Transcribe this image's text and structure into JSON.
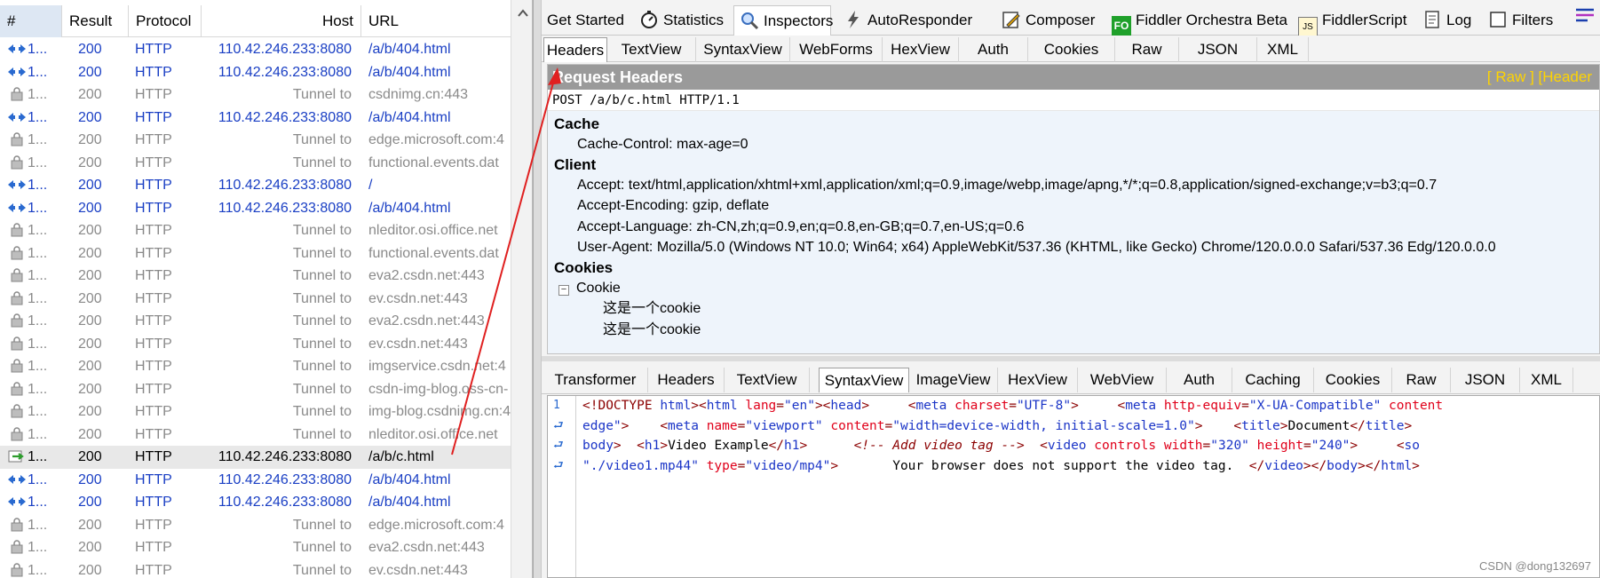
{
  "list": {
    "columns": [
      "#",
      "Result",
      "Protocol",
      "Host",
      "URL"
    ],
    "rows": [
      {
        "num": "1...",
        "result": "200",
        "protocol": "HTTP",
        "host": "110.42.246.233:8080",
        "url": "/a/b/404.html",
        "kind": "req",
        "icon": "arrows-icon"
      },
      {
        "num": "1...",
        "result": "200",
        "protocol": "HTTP",
        "host": "110.42.246.233:8080",
        "url": "/a/b/404.html",
        "kind": "req",
        "icon": "arrows-icon"
      },
      {
        "num": "1...",
        "result": "200",
        "protocol": "HTTP",
        "host": "Tunnel to",
        "url": "csdnimg.cn:443",
        "kind": "tunnel",
        "icon": "lock-icon"
      },
      {
        "num": "1...",
        "result": "200",
        "protocol": "HTTP",
        "host": "110.42.246.233:8080",
        "url": "/a/b/404.html",
        "kind": "req",
        "icon": "arrows-icon"
      },
      {
        "num": "1...",
        "result": "200",
        "protocol": "HTTP",
        "host": "Tunnel to",
        "url": "edge.microsoft.com:4",
        "kind": "tunnel",
        "icon": "lock-icon"
      },
      {
        "num": "1...",
        "result": "200",
        "protocol": "HTTP",
        "host": "Tunnel to",
        "url": "functional.events.dat",
        "kind": "tunnel",
        "icon": "lock-icon"
      },
      {
        "num": "1...",
        "result": "200",
        "protocol": "HTTP",
        "host": "110.42.246.233:8080",
        "url": "/",
        "kind": "req",
        "icon": "arrows-icon"
      },
      {
        "num": "1...",
        "result": "200",
        "protocol": "HTTP",
        "host": "110.42.246.233:8080",
        "url": "/a/b/404.html",
        "kind": "req",
        "icon": "arrows-icon"
      },
      {
        "num": "1...",
        "result": "200",
        "protocol": "HTTP",
        "host": "Tunnel to",
        "url": "nleditor.osi.office.net",
        "kind": "tunnel",
        "icon": "lock-icon"
      },
      {
        "num": "1...",
        "result": "200",
        "protocol": "HTTP",
        "host": "Tunnel to",
        "url": "functional.events.dat",
        "kind": "tunnel",
        "icon": "lock-icon"
      },
      {
        "num": "1...",
        "result": "200",
        "protocol": "HTTP",
        "host": "Tunnel to",
        "url": "eva2.csdn.net:443",
        "kind": "tunnel",
        "icon": "lock-icon"
      },
      {
        "num": "1...",
        "result": "200",
        "protocol": "HTTP",
        "host": "Tunnel to",
        "url": "ev.csdn.net:443",
        "kind": "tunnel",
        "icon": "lock-icon"
      },
      {
        "num": "1...",
        "result": "200",
        "protocol": "HTTP",
        "host": "Tunnel to",
        "url": "eva2.csdn.net:443",
        "kind": "tunnel",
        "icon": "lock-icon"
      },
      {
        "num": "1...",
        "result": "200",
        "protocol": "HTTP",
        "host": "Tunnel to",
        "url": "ev.csdn.net:443",
        "kind": "tunnel",
        "icon": "lock-icon"
      },
      {
        "num": "1...",
        "result": "200",
        "protocol": "HTTP",
        "host": "Tunnel to",
        "url": "imgservice.csdn.net:4",
        "kind": "tunnel",
        "icon": "lock-icon"
      },
      {
        "num": "1...",
        "result": "200",
        "protocol": "HTTP",
        "host": "Tunnel to",
        "url": "csdn-img-blog.oss-cn-",
        "kind": "tunnel",
        "icon": "lock-icon"
      },
      {
        "num": "1...",
        "result": "200",
        "protocol": "HTTP",
        "host": "Tunnel to",
        "url": "img-blog.csdnimg.cn:4",
        "kind": "tunnel",
        "icon": "lock-icon"
      },
      {
        "num": "1...",
        "result": "200",
        "protocol": "HTTP",
        "host": "Tunnel to",
        "url": "nleditor.osi.office.net",
        "kind": "tunnel",
        "icon": "lock-icon"
      },
      {
        "num": "1...",
        "result": "200",
        "protocol": "HTTP",
        "host": "110.42.246.233:8080",
        "url": "/a/b/c.html",
        "kind": "sel",
        "icon": "post-arrow-icon"
      },
      {
        "num": "1...",
        "result": "200",
        "protocol": "HTTP",
        "host": "110.42.246.233:8080",
        "url": "/a/b/404.html",
        "kind": "req",
        "icon": "arrows-icon"
      },
      {
        "num": "1...",
        "result": "200",
        "protocol": "HTTP",
        "host": "110.42.246.233:8080",
        "url": "/a/b/404.html",
        "kind": "req",
        "icon": "arrows-icon"
      },
      {
        "num": "1...",
        "result": "200",
        "protocol": "HTTP",
        "host": "Tunnel to",
        "url": "edge.microsoft.com:4",
        "kind": "tunnel",
        "icon": "lock-icon"
      },
      {
        "num": "1...",
        "result": "200",
        "protocol": "HTTP",
        "host": "Tunnel to",
        "url": "eva2.csdn.net:443",
        "kind": "tunnel",
        "icon": "lock-icon"
      },
      {
        "num": "1...",
        "result": "200",
        "protocol": "HTTP",
        "host": "Tunnel to",
        "url": "ev.csdn.net:443",
        "kind": "tunnel",
        "icon": "lock-icon"
      }
    ]
  },
  "top_tabs": [
    {
      "label": "Get Started",
      "icon": ""
    },
    {
      "label": "Statistics",
      "icon": "stopwatch-icon"
    },
    {
      "label": "Inspectors",
      "icon": "inspector-icon"
    },
    {
      "label": "AutoResponder",
      "icon": "lightning-icon"
    },
    {
      "label": "Composer",
      "icon": "composer-icon"
    },
    {
      "label": "Fiddler Orchestra Beta",
      "icon": "fo-icon"
    },
    {
      "label": "FiddlerScript",
      "icon": "js-icon"
    },
    {
      "label": "Log",
      "icon": "log-icon"
    },
    {
      "label": "Filters",
      "icon": "checkbox-icon"
    }
  ],
  "fo_badge": "FO",
  "js_badge": "JS",
  "request_tabs": [
    "Headers",
    "TextView",
    "SyntaxView",
    "WebForms",
    "HexView",
    "Auth",
    "Cookies",
    "Raw",
    "JSON",
    "XML"
  ],
  "response_tabs": [
    "Transformer",
    "Headers",
    "TextView",
    "SyntaxView",
    "ImageView",
    "HexView",
    "WebView",
    "Auth",
    "Caching",
    "Cookies",
    "Raw",
    "JSON",
    "XML"
  ],
  "request_headers": {
    "title": "Request Headers",
    "links": "[ Raw ]   [Header",
    "request_line": "POST /a/b/c.html HTTP/1.1",
    "groups": {
      "cache": "Cache",
      "cache_control": "Cache-Control: max-age=0",
      "client": "Client",
      "accept": "Accept: text/html,application/xhtml+xml,application/xml;q=0.9,image/webp,image/apng,*/*;q=0.8,application/signed-exchange;v=b3;q=0.7",
      "accept_encoding": "Accept-Encoding: gzip, deflate",
      "accept_language": "Accept-Language: zh-CN,zh;q=0.9,en;q=0.8,en-GB;q=0.7,en-US;q=0.6",
      "user_agent": "User-Agent: Mozilla/5.0 (Windows NT 10.0; Win64; x64) AppleWebKit/537.36 (KHTML, like Gecko) Chrome/120.0.0.0 Safari/537.36 Edg/120.0.0.0",
      "cookies": "Cookies",
      "cookie_node": "Cookie",
      "cookie_value_1": "这是一个cookie",
      "cookie_value_2": "这是一个cookie",
      "tree_toggle": "−"
    }
  },
  "code": {
    "line_number": "1",
    "wrap_glyph": "⮐",
    "lines": [
      [
        [
          "tag",
          "<!DOCTYPE "
        ],
        [
          "br",
          "html"
        ],
        [
          "tag",
          ">"
        ],
        [
          "tag",
          "<"
        ],
        [
          "br",
          "html "
        ],
        [
          "att",
          "lang"
        ],
        [
          "tag",
          "="
        ],
        [
          "val",
          "\"en\""
        ],
        [
          "tag",
          ">"
        ],
        [
          "tag",
          "<"
        ],
        [
          "br",
          "head"
        ],
        [
          "tag",
          ">"
        ],
        [
          "txt",
          "     "
        ],
        [
          "tag",
          "<"
        ],
        [
          "br",
          "meta "
        ],
        [
          "att",
          "charset"
        ],
        [
          "tag",
          "="
        ],
        [
          "val",
          "\"UTF-8\""
        ],
        [
          "tag",
          ">"
        ],
        [
          "txt",
          "     "
        ],
        [
          "tag",
          "<"
        ],
        [
          "br",
          "meta "
        ],
        [
          "att",
          "http-equiv"
        ],
        [
          "tag",
          "="
        ],
        [
          "val",
          "\"X-UA-Compatible\" "
        ],
        [
          "att",
          "content"
        ]
      ],
      [
        [
          "val",
          "edge\""
        ],
        [
          "tag",
          ">"
        ],
        [
          "txt",
          "    "
        ],
        [
          "tag",
          "<"
        ],
        [
          "br",
          "meta "
        ],
        [
          "att",
          "name"
        ],
        [
          "tag",
          "="
        ],
        [
          "val",
          "\"viewport\" "
        ],
        [
          "att",
          "content"
        ],
        [
          "tag",
          "="
        ],
        [
          "val",
          "\"width=device-width, initial-scale=1.0\""
        ],
        [
          "tag",
          ">"
        ],
        [
          "txt",
          "    "
        ],
        [
          "tag",
          "<"
        ],
        [
          "br",
          "title"
        ],
        [
          "tag",
          ">"
        ],
        [
          "txt",
          "Document"
        ],
        [
          "tag",
          "</"
        ],
        [
          "br",
          "title"
        ],
        [
          "tag",
          ">"
        ]
      ],
      [
        [
          "br",
          "body"
        ],
        [
          "tag",
          ">"
        ],
        [
          "txt",
          "  "
        ],
        [
          "tag",
          "<"
        ],
        [
          "br",
          "h1"
        ],
        [
          "tag",
          ">"
        ],
        [
          "txt",
          "Video Example"
        ],
        [
          "tag",
          "</"
        ],
        [
          "br",
          "h1"
        ],
        [
          "tag",
          ">"
        ],
        [
          "txt",
          "      "
        ],
        [
          "com",
          "<!-- Add video tag -->"
        ],
        [
          "txt",
          "  "
        ],
        [
          "tag",
          "<"
        ],
        [
          "br",
          "video "
        ],
        [
          "att",
          "controls "
        ],
        [
          "att",
          "width"
        ],
        [
          "tag",
          "="
        ],
        [
          "val",
          "\"320\" "
        ],
        [
          "att",
          "height"
        ],
        [
          "tag",
          "="
        ],
        [
          "val",
          "\"240\""
        ],
        [
          "tag",
          ">"
        ],
        [
          "txt",
          "     "
        ],
        [
          "tag",
          "<"
        ],
        [
          "br",
          "so"
        ]
      ],
      [
        [
          "val",
          "\"./video1.mp44\" "
        ],
        [
          "att",
          "type"
        ],
        [
          "tag",
          "="
        ],
        [
          "val",
          "\"video/mp4\""
        ],
        [
          "tag",
          ">"
        ],
        [
          "txt",
          "       Your browser does not support the video tag.  "
        ],
        [
          "tag",
          "</"
        ],
        [
          "br",
          "video"
        ],
        [
          "tag",
          "></"
        ],
        [
          "br",
          "body"
        ],
        [
          "tag",
          "></"
        ],
        [
          "br",
          "html"
        ],
        [
          "tag",
          ">"
        ]
      ]
    ]
  },
  "watermark": "CSDN @dong132697",
  "colors": {
    "request": "#1a3fc4",
    "tunnel": "#8a8a8a",
    "header_link": "#ffd400",
    "arrow": "#e02020"
  }
}
